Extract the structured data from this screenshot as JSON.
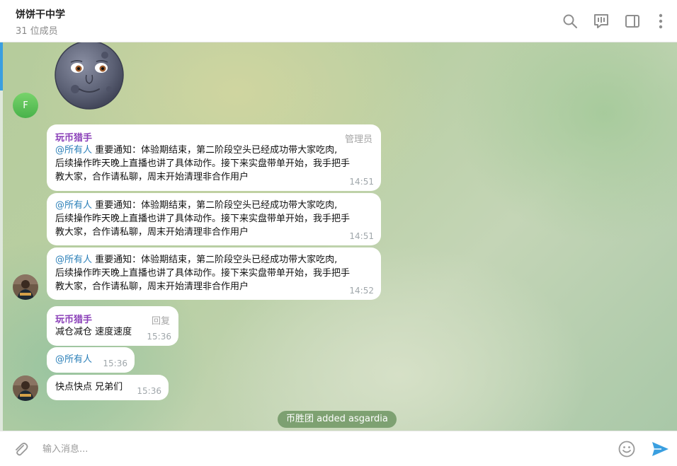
{
  "header": {
    "title": "饼饼干中学",
    "subtitle": "31 位成员",
    "icons": [
      "search-icon",
      "video-chat-icon",
      "sidebar-toggle-icon",
      "more-vertical-icon"
    ]
  },
  "chat": {
    "avatar_letter": "F",
    "messages": [
      {
        "sender": "玩币猎手",
        "role": "管理员",
        "mention": "@所有人",
        "text_line1": " 重要通知：体验期结束，第二阶段空头已经成功带大家吃肉,",
        "text_line2": "后续操作昨天晚上直播也讲了具体动作。接下来实盘带单开始，我手把手",
        "text_line3": "教大家，合作请私聊，周末开始清理非合作用户",
        "time": "14:51"
      },
      {
        "mention": "@所有人",
        "text_line1": " 重要通知：体验期结束，第二阶段空头已经成功带大家吃肉,",
        "text_line2": "后续操作昨天晚上直播也讲了具体动作。接下来实盘带单开始，我手把手",
        "text_line3": "教大家，合作请私聊，周末开始清理非合作用户",
        "time": "14:51"
      },
      {
        "mention": "@所有人",
        "text_line1": " 重要通知：体验期结束，第二阶段空头已经成功带大家吃肉,",
        "text_line2": "后续操作昨天晚上直播也讲了具体动作。接下来实盘带单开始，我手把手",
        "text_line3": "教大家，合作请私聊，周末开始清理非合作用户",
        "time": "14:52"
      },
      {
        "sender": "玩币猎手",
        "role": "回复",
        "text": "减仓减仓 速度速度",
        "time": "15:36"
      },
      {
        "mention": "@所有人",
        "time": "15:36"
      },
      {
        "text": "快点快点 兄弟们",
        "time": "15:36"
      }
    ],
    "service_message": "币胜团 added asgardia"
  },
  "composer": {
    "placeholder": "输入消息...",
    "icons": [
      "paperclip-icon",
      "emoji-icon",
      "send-icon"
    ]
  },
  "colors": {
    "accent": "#3a9fe0",
    "sender_name": "#8a3fb8",
    "mention": "#2a7fb8",
    "avatar_f": "#48b24a"
  }
}
